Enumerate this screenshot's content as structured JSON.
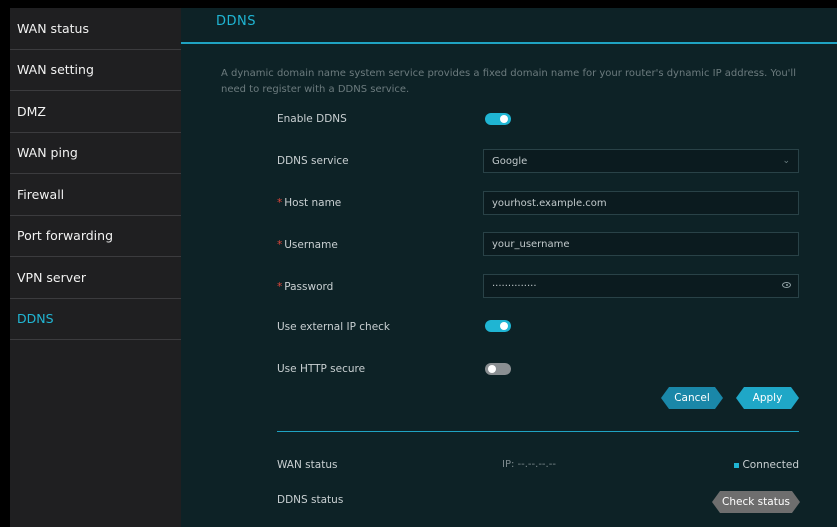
{
  "sidebar": {
    "items": [
      {
        "label": "WAN status"
      },
      {
        "label": "WAN setting"
      },
      {
        "label": "DMZ"
      },
      {
        "label": "WAN ping"
      },
      {
        "label": "Firewall"
      },
      {
        "label": "Port forwarding"
      },
      {
        "label": "VPN server"
      },
      {
        "label": "DDNS"
      }
    ],
    "active_index": 7
  },
  "page": {
    "title": "DDNS",
    "description": "A dynamic domain name system service provides a fixed domain name for your router's dynamic IP address. You'll need to register with a DDNS service."
  },
  "form": {
    "enable_ddns": {
      "label": "Enable DDNS",
      "on": true
    },
    "service": {
      "label": "DDNS service",
      "value": "Google"
    },
    "host": {
      "required_mark": "*",
      "label": "Host name",
      "value": "yourhost.example.com"
    },
    "username": {
      "required_mark": "*",
      "label": "Username",
      "value": "your_username"
    },
    "password": {
      "required_mark": "*",
      "label": "Password",
      "value": "··············"
    },
    "external_ip": {
      "label": "Use external IP check",
      "on": true
    },
    "http_secure": {
      "label": "Use HTTP secure",
      "on": false
    }
  },
  "buttons": {
    "cancel": "Cancel",
    "apply": "Apply",
    "check_status": "Check status"
  },
  "status": {
    "wan_label": "WAN status",
    "ip_text": "IP: --.--.--.--",
    "connection": "Connected",
    "ddns_label": "DDNS status"
  },
  "icons": {
    "dropdown": "chevron-down-icon",
    "reveal": "eye-icon",
    "indicator": "status-dot-icon"
  },
  "colors": {
    "accent": "#1fb5d3",
    "panel": "#0d2226",
    "sidebar": "#1f1f21",
    "required": "#e0463a"
  }
}
